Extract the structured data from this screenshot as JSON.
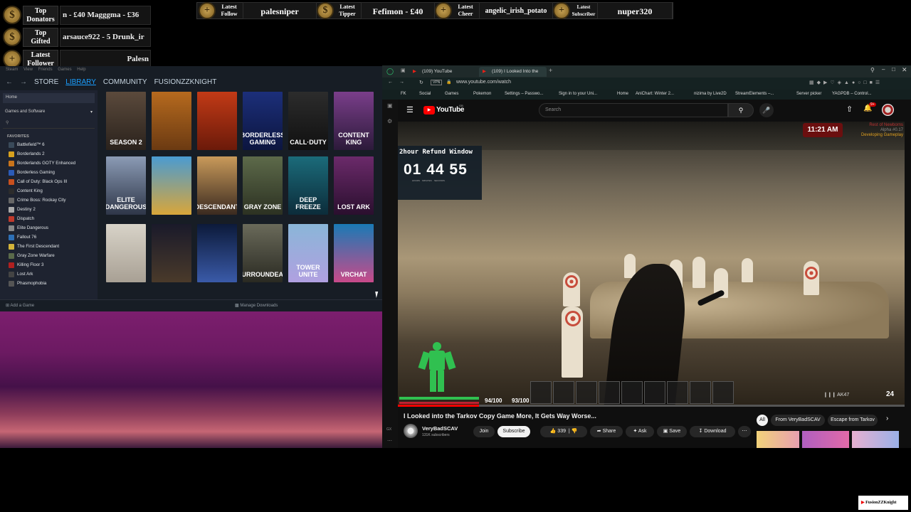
{
  "overlay": {
    "left_rows": [
      {
        "label_l1": "Top",
        "label_l2": "Donators",
        "value": "n - £40     Magggma - £36",
        "coin": "$"
      },
      {
        "label_l1": "Top",
        "label_l2": "Gifted",
        "value": "arsauce922 - 5     Drunk_ir",
        "coin": "$"
      },
      {
        "label_l1": "Latest",
        "label_l2": "Follower",
        "value": "Palesn",
        "coin": "+"
      }
    ],
    "top_items": [
      {
        "label_l1": "Latest",
        "label_l2": "Follow",
        "value": "palesniper",
        "coin": "+"
      },
      {
        "label_l1": "Latest",
        "label_l2": "Tipper",
        "value": "Fefimon - £40",
        "coin": "$"
      },
      {
        "label_l1": "Latest",
        "label_l2": "Cheer",
        "value": "angelic_irish_potato",
        "coin": "+"
      },
      {
        "label_l1": "Latest",
        "label_l2": "Subscriber",
        "value": "nuper320",
        "coin": "+"
      }
    ]
  },
  "steam": {
    "menu": "Steam  View  Friends  Games  Help",
    "nav": {
      "store": "STORE",
      "library": "LIBRARY",
      "community": "COMMUNITY",
      "user": "FUSIONZZKNIGHT"
    },
    "home": "Home",
    "filter": "Games and Software",
    "favorites_header": "FAVORITES",
    "games": [
      {
        "name": "Battlefield™ 6",
        "color": "#3a4a5a"
      },
      {
        "name": "Borderlands 2",
        "color": "#d8a11e"
      },
      {
        "name": "Borderlands GOTY Enhanced",
        "color": "#c9741b"
      },
      {
        "name": "Borderless Gaming",
        "color": "#2b5bb7"
      },
      {
        "name": "Call of Duty: Black Ops III",
        "color": "#c8501e"
      },
      {
        "name": "Content King",
        "color": "#2c2c2c"
      },
      {
        "name": "Crime Boss: Rockay City",
        "color": "#666"
      },
      {
        "name": "Destiny 2",
        "color": "#aaaaaa"
      },
      {
        "name": "Dispatch",
        "color": "#c0392b"
      },
      {
        "name": "Elite Dangerous",
        "color": "#888"
      },
      {
        "name": "Fallout 76",
        "color": "#2d6fb5"
      },
      {
        "name": "The First Descendant",
        "color": "#d4b43a"
      },
      {
        "name": "Gray Zone Warfare",
        "color": "#5a6a4a"
      },
      {
        "name": "Killing Floor 3",
        "color": "#b02020"
      },
      {
        "name": "Lost Ark",
        "color": "#444"
      },
      {
        "name": "Phasmophobia",
        "color": "#555"
      }
    ],
    "tiles": [
      {
        "title": "SEASON 2",
        "bg": "linear-gradient(180deg,#5b4a3c,#2a221c)"
      },
      {
        "title": "",
        "bg": "linear-gradient(180deg,#b66a1e,#6b3a12)"
      },
      {
        "title": "",
        "bg": "linear-gradient(180deg,#c23a16,#6b1a0a)"
      },
      {
        "title": "BORDERLESS GAMING",
        "bg": "linear-gradient(180deg,#1c2f7a,#0c153f)"
      },
      {
        "title": "CALL·DUTY",
        "bg": "linear-gradient(180deg,#2c2c2c,#101010)"
      },
      {
        "title": "CONTENT KING",
        "bg": "linear-gradient(180deg,#7a3e8a,#2c1a3a)"
      },
      {
        "title": "ELITE DANGEROUS",
        "bg": "linear-gradient(180deg,#8b9bb5,#2e3648)"
      },
      {
        "title": "",
        "bg": "linear-gradient(180deg,#4a9bd1,#d9a63a)"
      },
      {
        "title": "DESCENDANT",
        "bg": "linear-gradient(180deg,#c99a5a,#3a2a20)"
      },
      {
        "title": "GRAY ZONE",
        "bg": "linear-gradient(180deg,#5d6a4a,#2c3122)"
      },
      {
        "title": "DEEP FREEZE",
        "bg": "linear-gradient(180deg,#1b6b7a,#0c2c3a)"
      },
      {
        "title": "LOST ARK",
        "bg": "linear-gradient(180deg,#6b2a6a,#2a0f2e)"
      },
      {
        "title": "",
        "bg": "linear-gradient(180deg,#d8d3c8,#a8a094)"
      },
      {
        "title": "",
        "bg": "linear-gradient(180deg,#1a1a2a,#4a3a2a)"
      },
      {
        "title": "",
        "bg": "linear-gradient(180deg,#0c1a3a,#3a5aa8)"
      },
      {
        "title": "SURROUNDEAD",
        "bg": "linear-gradient(180deg,#6a6a5a,#2a2a22)"
      },
      {
        "title": "TOWER UNITE",
        "bg": "linear-gradient(180deg,#8ab6d8,#b0a0e0)"
      },
      {
        "title": "VRCHAT",
        "bg": "linear-gradient(180deg,#1a7ab5,#c84a8a)"
      }
    ],
    "add_game": "Add a Game",
    "manage_downloads": "Manage Downloads"
  },
  "browser": {
    "tabs": [
      {
        "label": "(109) YouTube"
      },
      {
        "label": "(109) I Looked Into the"
      }
    ],
    "url": "www.youtube.com/watch",
    "bookmarks": [
      "FK",
      "Social",
      "Games",
      "Pokemon",
      "Settings – Passwo...",
      "Sign in to your Uni...",
      "Home",
      "AniChart: Winter 2...",
      "nizima by Live2D",
      "StreamElements –...",
      "Server picker",
      "YAGPDB – Control..."
    ],
    "yt": {
      "logo": "YouTube",
      "logo_sup": "GB",
      "search_placeholder": "Search",
      "notif_count": "9+",
      "video_clock": "11:21 AM",
      "refund_title": "2hour Refund Window",
      "refund_timer": "01 44 55",
      "refund_units": "HOURS    MINUTES    SECONDS",
      "corner_line1": "Rest of Newborns",
      "corner_line2": "Alpha #0.17",
      "corner_line3": "Developing Gameplay",
      "hud_health": "94/100",
      "hud_stamina": "93/100",
      "hud_weapon": "AK47",
      "hud_ammo": "24",
      "title": "I Looked into the Tarkov Copy Game More, It Gets Way Worse...",
      "channel": "VeryBadSCAV",
      "subs": "131K subscribers",
      "join": "Join",
      "subscribe": "Subscribe",
      "likes": "339",
      "share": "Share",
      "ask": "Ask",
      "save": "Save",
      "download": "Download",
      "chips": [
        "All",
        "From VeryBadSCAV",
        "Escape from Tarkov"
      ]
    }
  },
  "stream_tag": "FusionZZKnight"
}
